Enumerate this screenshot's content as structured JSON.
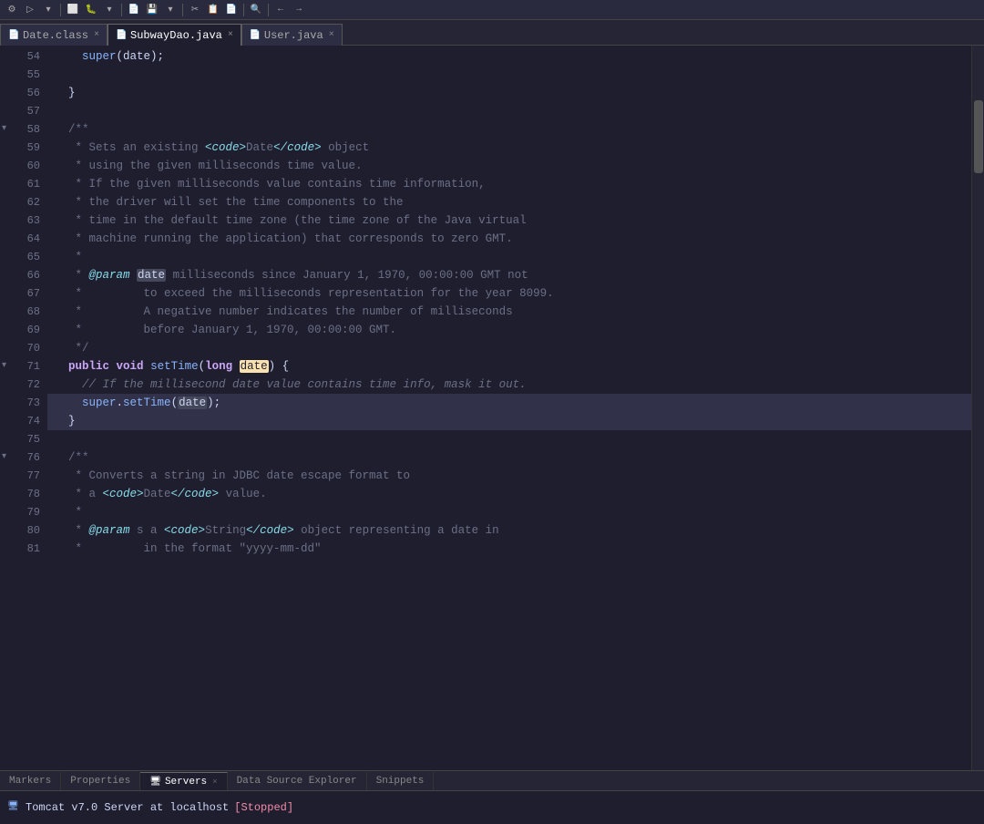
{
  "toolbar": {
    "icons": [
      "⚙",
      "▶",
      "⏸",
      "⏹",
      "🔧",
      "📁",
      "💾",
      "✂",
      "📋",
      "🔍",
      "🐛",
      "▷",
      "⏯"
    ]
  },
  "tabs": [
    {
      "id": "date-class",
      "label": "Date.class",
      "icon": "📄",
      "active": false,
      "closeable": true
    },
    {
      "id": "subway-dao",
      "label": "SubwayDao.java",
      "icon": "📄",
      "active": true,
      "closeable": true
    },
    {
      "id": "user-java",
      "label": "User.java",
      "icon": "📄",
      "active": false,
      "closeable": true
    }
  ],
  "editor": {
    "lines": [
      {
        "num": "54",
        "content": "    super(date);",
        "tokens": [
          {
            "text": "    "
          },
          {
            "text": "super",
            "cls": "kw2"
          },
          {
            "text": "(date);"
          }
        ]
      },
      {
        "num": "55",
        "content": ""
      },
      {
        "num": "56",
        "content": "  }",
        "tokens": [
          {
            "text": "  }"
          }
        ]
      },
      {
        "num": "57",
        "content": ""
      },
      {
        "num": "58",
        "content": "  /**",
        "collapse": true,
        "tokens": [
          {
            "text": "  /**",
            "cls": "comment-doc"
          }
        ]
      },
      {
        "num": "59",
        "content": "   * Sets an existing <code>Date</code> object",
        "tokens": [
          {
            "text": "   * Sets an existing ",
            "cls": "comment-doc"
          },
          {
            "text": "<code>",
            "cls": "comment-tag"
          },
          {
            "text": "Date",
            "cls": "comment-doc"
          },
          {
            "text": "</code>",
            "cls": "comment-tag"
          },
          {
            "text": " object",
            "cls": "comment-doc"
          }
        ]
      },
      {
        "num": "60",
        "content": "   * using the given milliseconds time value.",
        "tokens": [
          {
            "text": "   * using the given milliseconds time value.",
            "cls": "comment-doc"
          }
        ]
      },
      {
        "num": "61",
        "content": "   * If the given milliseconds value contains time information,",
        "tokens": [
          {
            "text": "   * If the given milliseconds value contains time information,",
            "cls": "comment-doc"
          }
        ]
      },
      {
        "num": "62",
        "content": "   * the driver will set the time components to the",
        "tokens": [
          {
            "text": "   * the driver will set the time components to the",
            "cls": "comment-doc"
          }
        ]
      },
      {
        "num": "63",
        "content": "   * time in the default time zone (the time zone of the Java virtual",
        "tokens": [
          {
            "text": "   * time in the default time zone (the time zone of the Java virtual",
            "cls": "comment-doc"
          }
        ]
      },
      {
        "num": "64",
        "content": "   * machine running the application) that corresponds to zero GMT.",
        "tokens": [
          {
            "text": "   * machine running the application) that corresponds to zero GMT.",
            "cls": "comment-doc"
          }
        ]
      },
      {
        "num": "65",
        "content": "   *",
        "tokens": [
          {
            "text": "   *",
            "cls": "comment-doc"
          }
        ]
      },
      {
        "num": "66",
        "content": "   * @param date milliseconds since January 1, 1970, 00:00:00 GMT not",
        "tokens": [
          {
            "text": "   * ",
            "cls": "comment-doc"
          },
          {
            "text": "@param",
            "cls": "comment-tag"
          },
          {
            "text": " ",
            "cls": "comment-doc"
          },
          {
            "text": "date",
            "cls": "param-highlight"
          },
          {
            "text": " milliseconds since January 1, 1970, 00:00:00 GMT not",
            "cls": "comment-doc"
          }
        ]
      },
      {
        "num": "67",
        "content": "   *         to exceed the milliseconds representation for the year 8099.",
        "tokens": [
          {
            "text": "   *         to exceed the milliseconds representation for the year 8099.",
            "cls": "comment-doc"
          }
        ]
      },
      {
        "num": "68",
        "content": "   *         A negative number indicates the number of milliseconds",
        "tokens": [
          {
            "text": "   *         A negative number indicates the number of milliseconds",
            "cls": "comment-doc"
          }
        ]
      },
      {
        "num": "69",
        "content": "   *         before January 1, 1970, 00:00:00 GMT.",
        "tokens": [
          {
            "text": "   *         before January 1, 1970, 00:00:00 GMT.",
            "cls": "comment-doc"
          }
        ]
      },
      {
        "num": "70",
        "content": "   */",
        "tokens": [
          {
            "text": "   */",
            "cls": "comment-doc"
          }
        ]
      },
      {
        "num": "71",
        "content": "  public void setTime(long date) {",
        "collapse": true,
        "tokens": [
          {
            "text": "  "
          },
          {
            "text": "public",
            "cls": "kw"
          },
          {
            "text": " "
          },
          {
            "text": "void",
            "cls": "kw"
          },
          {
            "text": " "
          },
          {
            "text": "setTime",
            "cls": "method"
          },
          {
            "text": "("
          },
          {
            "text": "long",
            "cls": "kw"
          },
          {
            "text": " "
          },
          {
            "text": "date",
            "cls": "highlight-box"
          },
          {
            "text": ") {"
          }
        ]
      },
      {
        "num": "72",
        "content": "    // If the millisecond date value contains time info, mask it out.",
        "tokens": [
          {
            "text": "    // If the millisecond date value contains time info, mask it out.",
            "cls": "comment"
          }
        ]
      },
      {
        "num": "73",
        "content": "    super.setTime(date);",
        "selected": true,
        "tokens": [
          {
            "text": "    "
          },
          {
            "text": "super",
            "cls": "kw2"
          },
          {
            "text": "."
          },
          {
            "text": "setTime",
            "cls": "method"
          },
          {
            "text": "("
          },
          {
            "text": "date",
            "cls": "param-highlight"
          },
          {
            "text": ");"
          }
        ]
      },
      {
        "num": "74",
        "content": "  }",
        "selected": true,
        "tokens": [
          {
            "text": "  }"
          }
        ]
      },
      {
        "num": "75",
        "content": ""
      },
      {
        "num": "76",
        "content": "  /**",
        "collapse": true,
        "tokens": [
          {
            "text": "  /**",
            "cls": "comment-doc"
          }
        ]
      },
      {
        "num": "77",
        "content": "   * Converts a string in JDBC date escape format to",
        "tokens": [
          {
            "text": "   * Converts a string in JDBC date escape format to",
            "cls": "comment-doc"
          }
        ]
      },
      {
        "num": "78",
        "content": "   * a <code>Date</code> value.",
        "tokens": [
          {
            "text": "   * a ",
            "cls": "comment-doc"
          },
          {
            "text": "<code>",
            "cls": "comment-tag"
          },
          {
            "text": "Date",
            "cls": "comment-doc"
          },
          {
            "text": "</code>",
            "cls": "comment-tag"
          },
          {
            "text": " value.",
            "cls": "comment-doc"
          }
        ]
      },
      {
        "num": "79",
        "content": "   *",
        "tokens": [
          {
            "text": "   *",
            "cls": "comment-doc"
          }
        ]
      },
      {
        "num": "80",
        "content": "   * @param s a <code>String</code> object representing a date in",
        "tokens": [
          {
            "text": "   * ",
            "cls": "comment-doc"
          },
          {
            "text": "@param",
            "cls": "comment-tag"
          },
          {
            "text": " s a ",
            "cls": "comment-doc"
          },
          {
            "text": "<code>",
            "cls": "comment-tag"
          },
          {
            "text": "String",
            "cls": "comment-doc"
          },
          {
            "text": "</code>",
            "cls": "comment-tag"
          },
          {
            "text": " object representing a date in",
            "cls": "comment-doc"
          }
        ]
      },
      {
        "num": "81",
        "content": "   *         in the format \"yyyy-mm-dd\"",
        "tokens": [
          {
            "text": "   *         in the format \"yyyy-mm-dd\"",
            "cls": "comment-doc"
          }
        ]
      }
    ]
  },
  "bottom_tabs": [
    {
      "id": "markers",
      "label": "Markers",
      "active": false
    },
    {
      "id": "properties",
      "label": "Properties",
      "active": false
    },
    {
      "id": "servers",
      "label": "Servers",
      "active": true,
      "closeable": true
    },
    {
      "id": "data-source",
      "label": "Data Source Explorer",
      "active": false
    },
    {
      "id": "snippets",
      "label": "Snippets",
      "active": false
    }
  ],
  "servers": [
    {
      "label": "Tomcat v7.0 Server at localhost",
      "status": "[Stopped]"
    }
  ],
  "cursor_line": 73
}
